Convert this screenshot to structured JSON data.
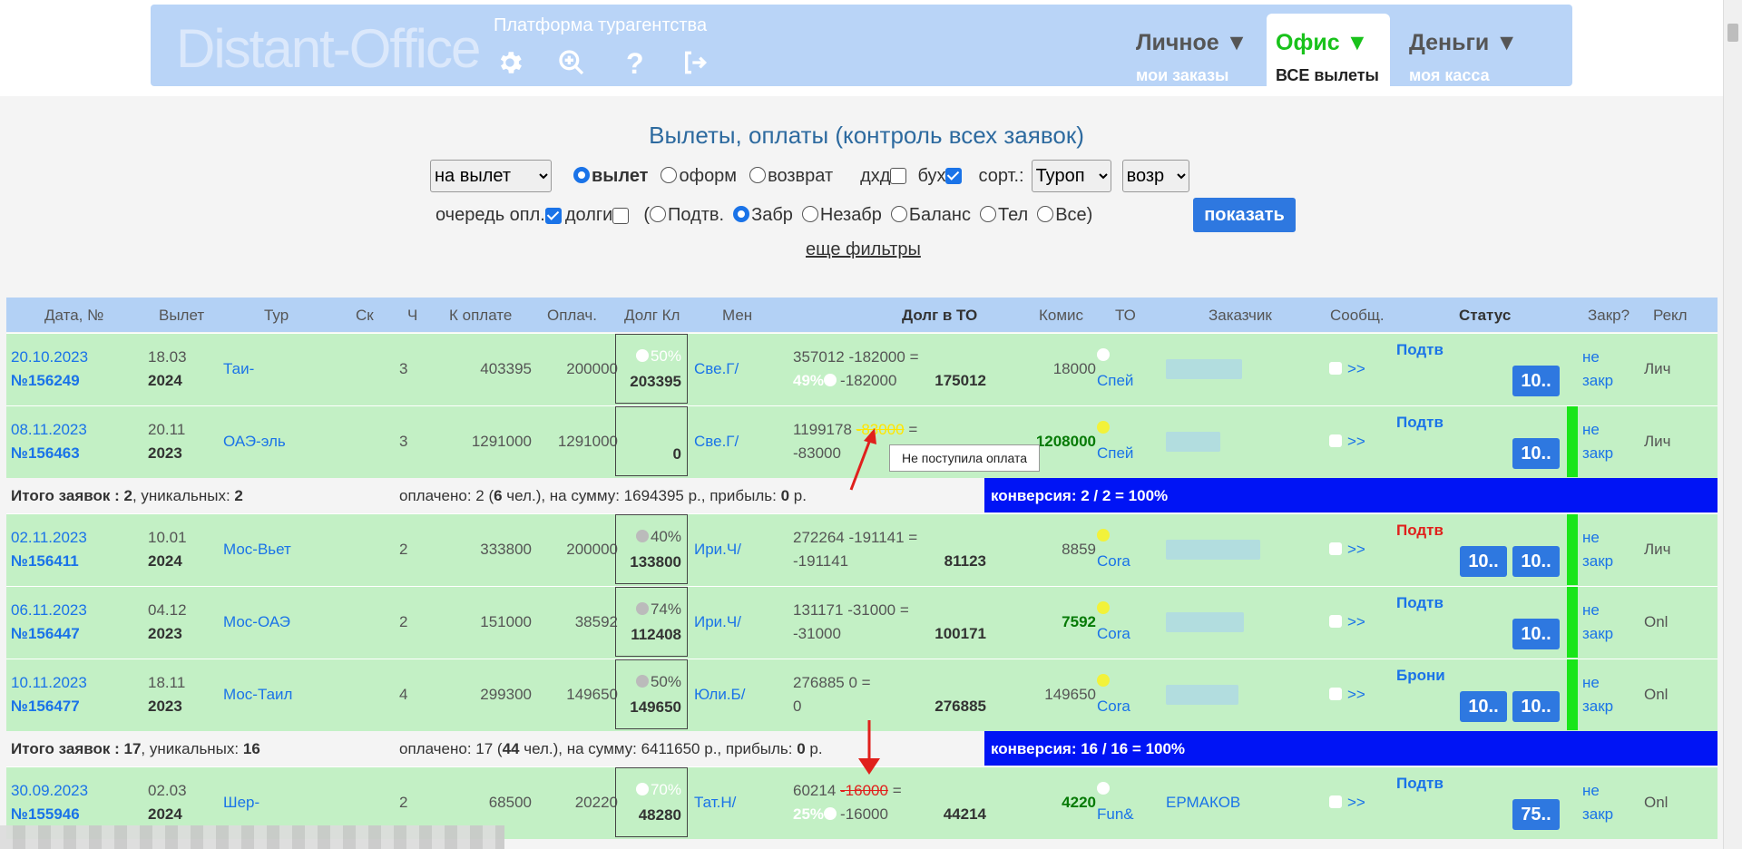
{
  "header": {
    "logo": "Distant-Office",
    "platform": "Платформа турагентства",
    "menus": [
      {
        "title": "Личное ▼",
        "sub": "мои заказы"
      },
      {
        "title": "Офис ▼",
        "sub": "ВСЕ вылеты"
      },
      {
        "title": "Деньги ▼",
        "sub": "моя касса"
      }
    ]
  },
  "page_title": "Вылеты, оплаты (контроль всех заявок)",
  "filters": {
    "period": "на вылет",
    "r_vylet": "вылет",
    "r_oform": "оформ",
    "r_vozvrat": "возврат",
    "dhd": "дхд",
    "buh": "бух",
    "sort": "сорт.:",
    "sort_value": "Туроп",
    "sort2": "возр",
    "queue": "очередь опл.",
    "debts": "долги",
    "open_paren": "(",
    "r_podtv": "Подтв.",
    "r_zabr": "Забр",
    "r_nezabr": "Незабр",
    "r_balans": "Баланс",
    "r_tel": "Тел",
    "r_vse": "Все)",
    "show": "показать",
    "more": "еще фильтры"
  },
  "columns": [
    "Дата, №",
    "Вылет",
    "Тур",
    "Ск",
    "Ч",
    "К оплате",
    "Оплач.",
    "Долг Кл",
    "Мен",
    "Долг в ТО",
    "Комис",
    "ТО",
    "Заказчик",
    "Сообщ.",
    "Статус",
    "Закр?",
    "Рекл"
  ],
  "rows": [
    {
      "date": "20.10.2023",
      "num": "№156249",
      "fd": "18.03",
      "fy": "2024",
      "tour": "Таи-",
      "ch": "3",
      "topay": "403395",
      "paid": "200000",
      "pct": "50%",
      "debt": "203395",
      "man": "Све.Г/",
      "to1": "357012 -182000 =",
      "to2a": "49%",
      "to2b": "-182000",
      "tosum": "175012",
      "komis": "18000",
      "op": "Спей",
      "msg": ">>",
      "status": "Подтв",
      "btns": [
        "10.."
      ],
      "zakr1": "не",
      "zakr2": "закр",
      "rekl": "Лич"
    },
    {
      "date": "08.11.2023",
      "num": "№156463",
      "fd": "20.11",
      "fy": "2023",
      "tour": "ОАЭ-эль",
      "ch": "3",
      "topay": "1291000",
      "paid": "1291000",
      "pct": "",
      "debt": "0",
      "man": "Све.Г/",
      "to1": "1199178",
      "to1b": "-83000",
      "to1c": "=",
      "to2a": "",
      "to2b": "-83000",
      "tosum": "",
      "komis": "1208000",
      "op": "Спей",
      "msg": ">>",
      "status": "Подтв",
      "btns": [
        "10.."
      ],
      "zakr1": "не",
      "zakr2": "закр",
      "rekl": "Лич"
    },
    {
      "date": "02.11.2023",
      "num": "№156411",
      "fd": "10.01",
      "fy": "2024",
      "tour": "Мос-Вьет",
      "ch": "2",
      "topay": "333800",
      "paid": "200000",
      "pct": "40%",
      "debt": "133800",
      "man": "Ири.Ч/",
      "to1": "272264 -191141 =",
      "to2a": "",
      "to2b": "-191141",
      "tosum": "81123",
      "komis": "8859",
      "op": "Cora",
      "msg": ">>",
      "status": "Подтв",
      "btns": [
        "10..",
        "10.."
      ],
      "zakr1": "не",
      "zakr2": "закр",
      "rekl": "Лич"
    },
    {
      "date": "06.11.2023",
      "num": "№156447",
      "fd": "04.12",
      "fy": "2023",
      "tour": "Мос-ОАЭ",
      "ch": "2",
      "topay": "151000",
      "paid": "38592",
      "pct": "74%",
      "debt": "112408",
      "man": "Ири.Ч/",
      "to1": "131171 -31000 =",
      "to2a": "",
      "to2b": "-31000",
      "tosum": "100171",
      "komis": "7592",
      "op": "Cora",
      "msg": ">>",
      "status": "Подтв",
      "btns": [
        "10.."
      ],
      "zakr1": "не",
      "zakr2": "закр",
      "rekl": "Onl"
    },
    {
      "date": "10.11.2023",
      "num": "№156477",
      "fd": "18.11",
      "fy": "2023",
      "tour": "Мос-Таил",
      "ch": "4",
      "topay": "299300",
      "paid": "149650",
      "pct": "50%",
      "debt": "149650",
      "man": "Юли.Б/",
      "to1": "276885 0 =",
      "to2a": "",
      "to2b": "0",
      "tosum": "276885",
      "komis": "149650",
      "op": "Cora",
      "msg": ">>",
      "status": "Брони",
      "btns": [
        "10..",
        "10.."
      ],
      "zakr1": "не",
      "zakr2": "закр",
      "rekl": "Onl"
    },
    {
      "date": "30.09.2023",
      "num": "№155946",
      "fd": "02.03",
      "fy": "2024",
      "tour": "Шер-",
      "ch": "2",
      "topay": "68500",
      "paid": "20220",
      "pct": "70%",
      "debt": "48280",
      "man": "Тат.Н/",
      "to1": "60214",
      "to1b": "-16000",
      "to1c": "=",
      "to2a": "25%",
      "to2b": "-16000",
      "tosum": "44214",
      "komis": "4220",
      "op": "Fun&",
      "customer": "ЕРМАКОВ",
      "msg": ">>",
      "status": "Подтв",
      "btns": [
        "75.."
      ],
      "zakr1": "не",
      "zakr2": "закр",
      "rekl": "Onl"
    }
  ],
  "summaries": [
    {
      "a": "Итого заявок : ",
      "b": "2",
      "c": ", уникальных: ",
      "d": "2",
      "e": "оплачено: 2 (",
      "f": "6",
      "g": " чел.), на сумму: 1694395 р., прибыль: ",
      "h": "0",
      "i": " р.",
      "conv": "конверсия: 2 / 2 = 100%"
    },
    {
      "a": "Итого заявок : ",
      "b": "17",
      "c": ", уникальных: ",
      "d": "16",
      "e": "оплачено: 17 (",
      "f": "44",
      "g": " чел.), на сумму: 6411650 р., прибыль: ",
      "h": "0",
      "i": " р.",
      "conv": "конверсия: 16 / 16 = 100%"
    }
  ],
  "tooltip": "Не поступила оплата",
  "colors": {
    "banner": "#b9d4f7",
    "row": "#c3f0c5",
    "header_row": "#b3d1f5",
    "conversion": "#0014f5",
    "accent": "#2e78e0",
    "green_bar": "#19e519",
    "red_status": "#e0201c"
  }
}
